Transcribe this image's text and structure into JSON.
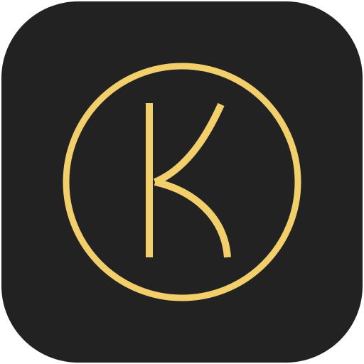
{
  "app_icon": {
    "logo_letter": "K",
    "colors": {
      "background": "#222222",
      "accent": "#F2CF6A"
    },
    "icon": "k-monogram-circle-icon"
  }
}
